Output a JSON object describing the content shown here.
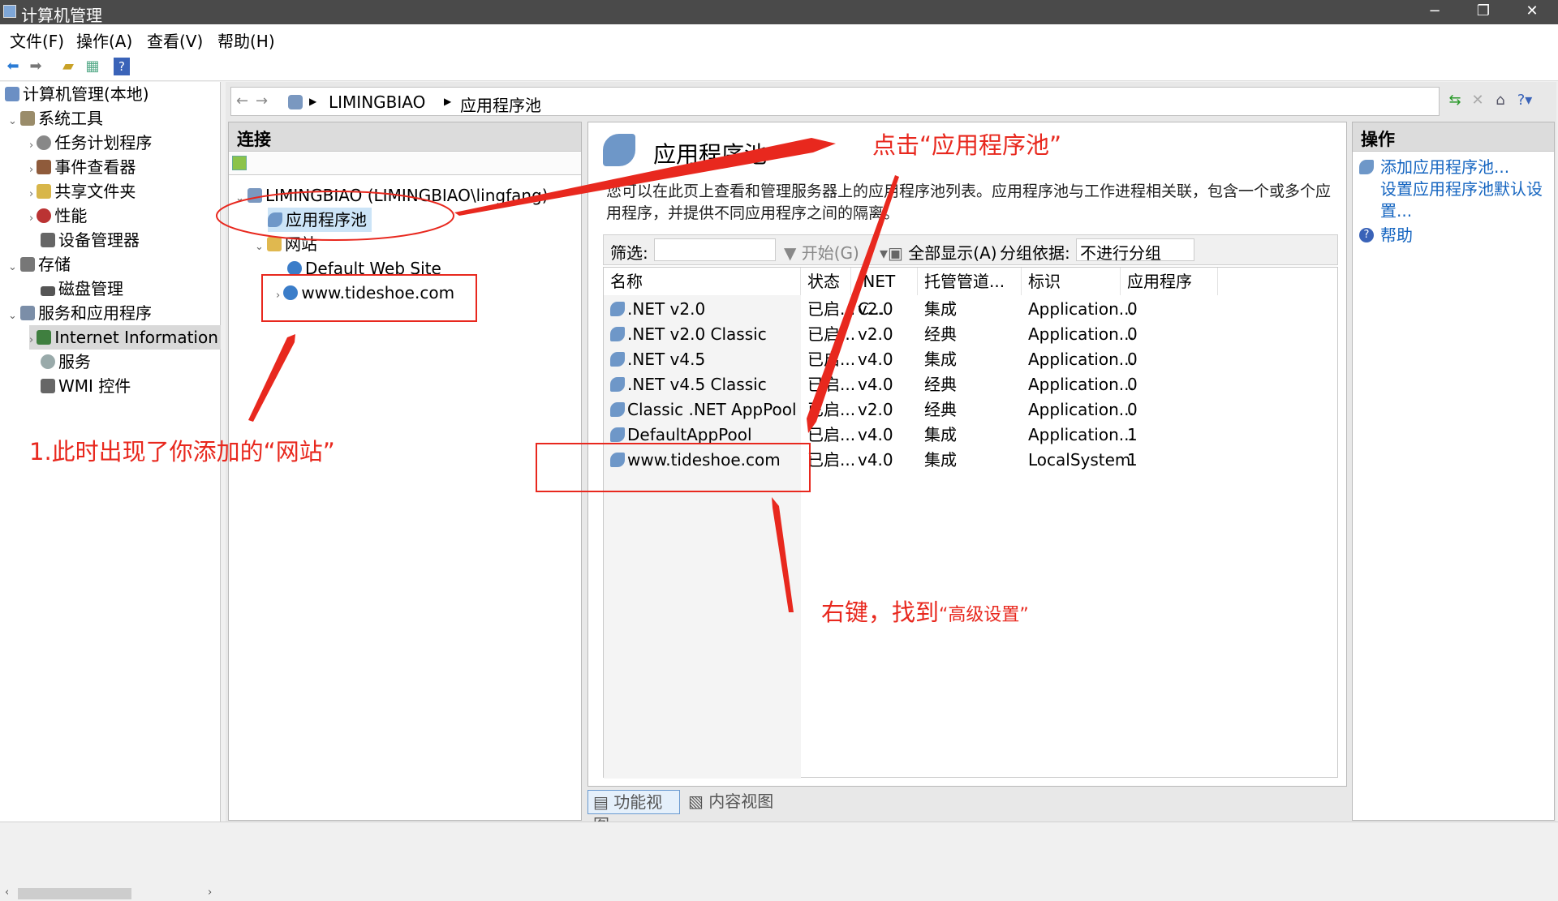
{
  "window": {
    "title": "计算机管理",
    "min": "−",
    "max": "❐",
    "close": "✕"
  },
  "menu": [
    "文件(F)",
    "操作(A)",
    "查看(V)",
    "帮助(H)"
  ],
  "left_tree": {
    "root": "计算机管理(本地)",
    "system_tools": "系统工具",
    "task_scheduler": "任务计划程序",
    "event_viewer": "事件查看器",
    "shared_folders": "共享文件夹",
    "performance": "性能",
    "device_manager": "设备管理器",
    "storage": "存储",
    "disk_mgmt": "磁盘管理",
    "services_apps": "服务和应用程序",
    "iis": "Internet Information",
    "services": "服务",
    "wmi": "WMI 控件"
  },
  "address": {
    "server": "LIMINGBIAO",
    "page": "应用程序池"
  },
  "connections": {
    "title": "连接",
    "server": "LIMINGBIAO (LIMINGBIAO\\lingfang)",
    "app_pools": "应用程序池",
    "sites": "网站",
    "default_site": "Default Web Site",
    "custom_site": "www.tideshoe.com"
  },
  "features": {
    "title": "应用程序池",
    "description": "您可以在此页上查看和管理服务器上的应用程序池列表。应用程序池与工作进程相关联，包含一个或多个应用程序，并提供不同应用程序之间的隔离。",
    "filter_label": "筛选:",
    "start": "开始(G)",
    "show_all": "全部显示(A)",
    "group_label": "分组依据:",
    "group_value": "不进行分组"
  },
  "grid": {
    "headers": [
      "名称",
      "状态",
      ".NET C...",
      "托管管道...",
      "标识",
      "应用程序"
    ],
    "rows": [
      [
        ".NET v2.0",
        "已启...",
        "v2.0",
        "集成",
        "Application...",
        "0"
      ],
      [
        ".NET v2.0 Classic",
        "已启...",
        "v2.0",
        "经典",
        "Application...",
        "0"
      ],
      [
        ".NET v4.5",
        "已启...",
        "v4.0",
        "集成",
        "Application...",
        "0"
      ],
      [
        ".NET v4.5 Classic",
        "已启...",
        "v4.0",
        "经典",
        "Application...",
        "0"
      ],
      [
        "Classic .NET AppPool",
        "已启...",
        "v2.0",
        "经典",
        "Application...",
        "0"
      ],
      [
        "DefaultAppPool",
        "已启...",
        "v4.0",
        "集成",
        "Application...",
        "1"
      ],
      [
        "www.tideshoe.com",
        "已启...",
        "v4.0",
        "集成",
        "LocalSystem",
        "1"
      ]
    ]
  },
  "view_tabs": {
    "features": "功能视图",
    "content": "内容视图"
  },
  "actions": {
    "title": "操作",
    "add_pool": "添加应用程序池...",
    "set_defaults": "设置应用程序池默认设置...",
    "help": "帮助"
  },
  "annotations": {
    "click_pools": "点击“应用程序池”",
    "site_appeared": "1.此时出现了你添加的“网站”",
    "right_click_prefix": "右键，找到",
    "right_click_quote": "“高级设置”"
  },
  "colors": {
    "annotation": "#e8281e",
    "link": "#1565c0",
    "selection": "#cce4f7"
  }
}
